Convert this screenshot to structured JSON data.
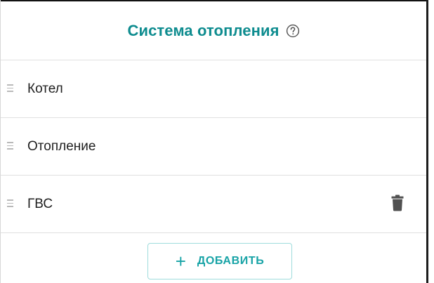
{
  "panel": {
    "title": "Система отопления",
    "help_icon": "help-circle-icon"
  },
  "circuits": [
    {
      "label": "Котел",
      "handle_icon": "drag-handle-icon",
      "deletable": false
    },
    {
      "label": "Отопление",
      "handle_icon": "drag-handle-icon",
      "deletable": false
    },
    {
      "label": "ГВС",
      "handle_icon": "drag-handle-icon",
      "deletable": true,
      "delete_icon": "trash-icon"
    }
  ],
  "add_button": {
    "icon": "plus-icon",
    "icon_glyph": "+",
    "label": "ДОБАВИТЬ"
  },
  "colors": {
    "accent": "#0e8c8f",
    "button_text": "#17a3a6",
    "button_border": "#9fdcdc",
    "divider": "#e0e0e0",
    "icon_gray": "#505050"
  }
}
